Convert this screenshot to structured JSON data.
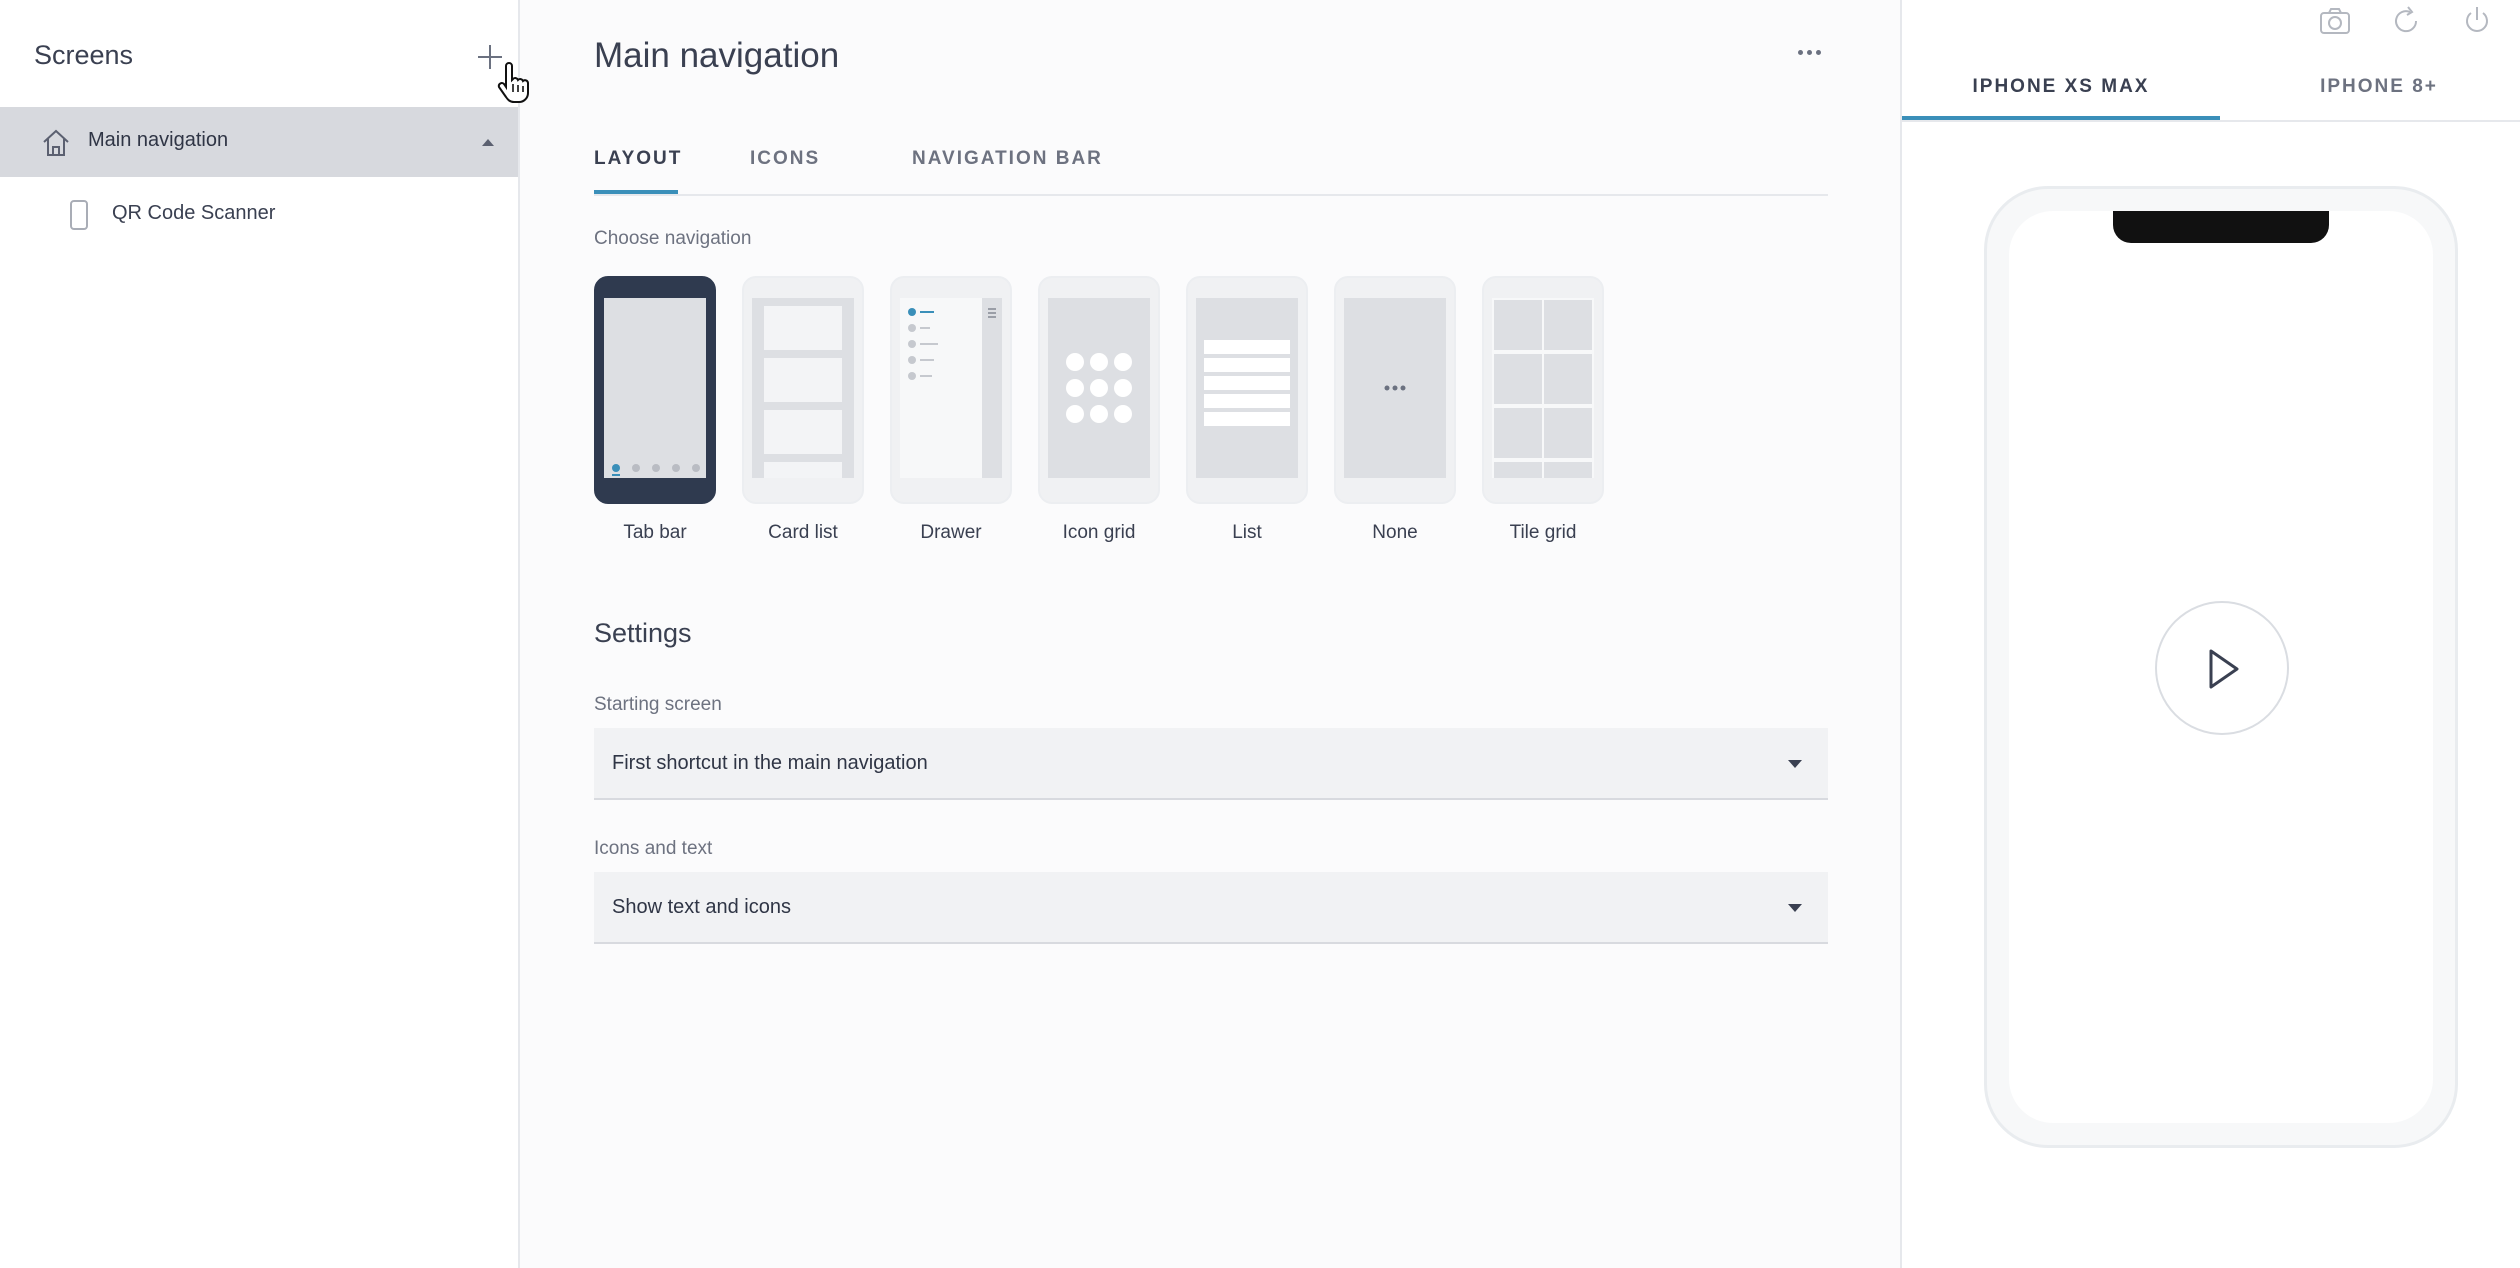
{
  "sidebar": {
    "title": "Screens",
    "items": [
      {
        "label": "Main navigation",
        "icon": "home-icon",
        "expanded": true,
        "selected": true
      },
      {
        "label": "QR Code Scanner",
        "icon": "phone-icon"
      }
    ]
  },
  "main": {
    "title": "Main navigation",
    "tabs": [
      {
        "label": "LAYOUT",
        "active": true
      },
      {
        "label": "ICONS"
      },
      {
        "label": "NAVIGATION BAR"
      }
    ],
    "choose_navigation_label": "Choose navigation",
    "navigation_options": [
      {
        "label": "Tab bar",
        "selected": true
      },
      {
        "label": "Card list"
      },
      {
        "label": "Drawer"
      },
      {
        "label": "Icon grid"
      },
      {
        "label": "List"
      },
      {
        "label": "None"
      },
      {
        "label": "Tile grid"
      }
    ],
    "settings": {
      "title": "Settings",
      "starting_screen": {
        "label": "Starting screen",
        "value": "First shortcut in the main navigation"
      },
      "icons_and_text": {
        "label": "Icons and text",
        "value": "Show text and icons"
      }
    }
  },
  "preview": {
    "top_icons": [
      "camera-icon",
      "refresh-icon",
      "power-icon"
    ],
    "device_tabs": [
      {
        "label": "IPHONE XS MAX",
        "active": true
      },
      {
        "label": "IPHONE 8+"
      }
    ]
  },
  "colors": {
    "accent": "#3a8fb9",
    "selected_thumb": "#2f3a4f",
    "sidebar_selected": "#d7d9de"
  }
}
